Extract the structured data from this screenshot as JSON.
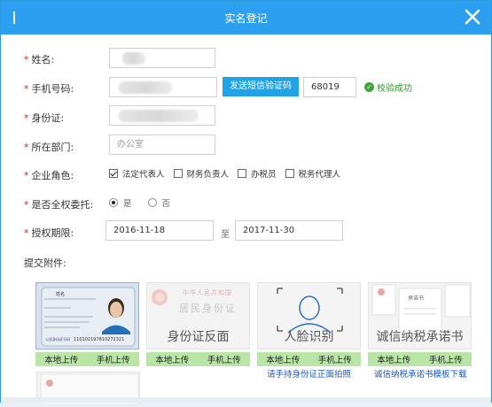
{
  "dialog": {
    "title": "实名登记",
    "close_glyph": "✕"
  },
  "form": {
    "name": {
      "label": "姓名:",
      "value": ""
    },
    "phone": {
      "label": "手机号码:",
      "value": "",
      "sms_button": "发送短信验证码",
      "code_value": "68019",
      "verify_status": "校验成功",
      "verify_icon": "check-circle-icon",
      "verify_color": "#39a839"
    },
    "id_card": {
      "label": "身份证:",
      "value": ""
    },
    "department": {
      "label": "所在部门:",
      "placeholder": "办公室"
    },
    "role": {
      "label": "企业角色:",
      "options": [
        {
          "label": "法定代表人",
          "checked": true
        },
        {
          "label": "财务负责人",
          "checked": false
        },
        {
          "label": "办税员",
          "checked": false
        },
        {
          "label": "税务代理人",
          "checked": false
        }
      ]
    },
    "full_authority": {
      "label": "是否全权委托:",
      "options": [
        {
          "label": "是",
          "selected": true
        },
        {
          "label": "否",
          "selected": false
        }
      ]
    },
    "period": {
      "label": "授权期限:",
      "start": "2016-11-18",
      "separator": "至",
      "end": "2017-11-30"
    },
    "required_mark": "*"
  },
  "attachments": {
    "label": "提交附件:",
    "cards": [
      {
        "caption": "",
        "id_name_field": "姓名",
        "id_number_label": "公民身份证号码",
        "id_number": "110102197810272321",
        "upload_local": "本地上传",
        "upload_mobile": "手机上传",
        "link": ""
      },
      {
        "caption": "身份证反面",
        "country": "中华人民共和国",
        "doc_title": "居民身份证",
        "upload_local": "本地上传",
        "upload_mobile": "手机上传",
        "link": ""
      },
      {
        "caption": "人脸识别",
        "upload_local": "本地上传",
        "upload_mobile": "手机上传",
        "link": "请手持身份证正面拍照"
      },
      {
        "caption": "诚信纳税承诺书",
        "doc_title": "承诺书",
        "upload_local": "本地上传",
        "upload_mobile": "手机上传",
        "link": "诚信纳税承诺书模板下载"
      }
    ]
  },
  "colors": {
    "titlebar": "#2d9ff0",
    "accent": "#1ea3e8",
    "upload_bar": "#b9e6a6",
    "required": "#e02020",
    "link": "#1a54c8"
  }
}
